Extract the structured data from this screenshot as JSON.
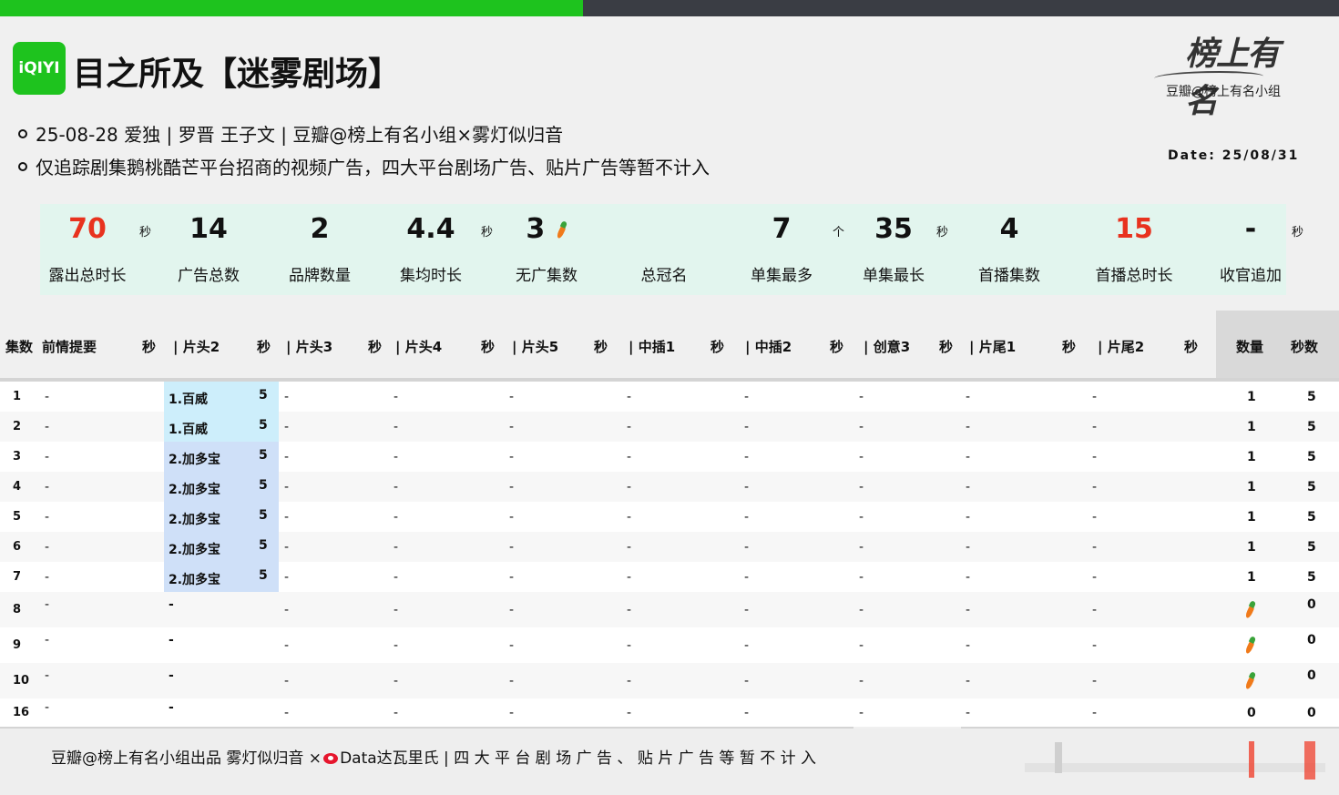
{
  "header": {
    "logo_text": "iQIYI",
    "title": "目之所及【迷雾剧场】",
    "brand_script": "榜上有名",
    "brand_sub": "豆瓣@榜上有名小组",
    "info_line1": "25-08-28  爱独 |  罗晋 王子文 | 豆瓣@榜上有名小组×雾灯似归音",
    "info_line2": "仅追踪剧集鹅桃酷芒平台招商的视频广告，四大平台剧场广告、贴片广告等暂不计入",
    "date": "Date: 25/08/31"
  },
  "stats": {
    "items": [
      {
        "value": "70",
        "label": "露出总时长",
        "red": true
      },
      {
        "value": "14",
        "label": "广告总数"
      },
      {
        "value": "2",
        "label": "品牌数量"
      },
      {
        "value": "4.4",
        "label": "集均时长"
      },
      {
        "value": "3",
        "label": "无广集数"
      },
      {
        "value": "",
        "label": "总冠名"
      },
      {
        "value": "7",
        "label": "单集最多"
      },
      {
        "value": "35",
        "label": "单集最长"
      },
      {
        "value": "4",
        "label": "首播集数"
      },
      {
        "value": "15",
        "label": "首播总时长",
        "red": true
      },
      {
        "value": "-",
        "label": "收官追加"
      }
    ],
    "unit_sec": "秒",
    "unit_ge": "个"
  },
  "table": {
    "headers": [
      "集数",
      "前情提要",
      "秒",
      "| 片头2",
      "秒",
      "| 片头3",
      "秒",
      "| 片头4",
      "秒",
      "| 片头5",
      "秒",
      "| 中插1",
      "秒",
      "| 中插2",
      "秒",
      "| 创意3",
      "秒",
      "| 片尾1",
      "秒",
      "| 片尾2",
      "秒",
      "数量",
      "秒数"
    ],
    "dash": "-",
    "rows": [
      {
        "ep": "1",
        "ad": "1.百威",
        "sec": "5",
        "count": "1",
        "secs": "5"
      },
      {
        "ep": "2",
        "ad": "1.百威",
        "sec": "5",
        "count": "1",
        "secs": "5"
      },
      {
        "ep": "3",
        "ad": "2.加多宝",
        "sec": "5",
        "count": "1",
        "secs": "5"
      },
      {
        "ep": "4",
        "ad": "2.加多宝",
        "sec": "5",
        "count": "1",
        "secs": "5"
      },
      {
        "ep": "5",
        "ad": "2.加多宝",
        "sec": "5",
        "count": "1",
        "secs": "5"
      },
      {
        "ep": "6",
        "ad": "2.加多宝",
        "sec": "5",
        "count": "1",
        "secs": "5"
      },
      {
        "ep": "7",
        "ad": "2.加多宝",
        "sec": "5",
        "count": "1",
        "secs": "5"
      },
      {
        "ep": "8",
        "ad": "-",
        "sec": "",
        "count": "carrot",
        "secs": "0"
      },
      {
        "ep": "9",
        "ad": "-",
        "sec": "",
        "count": "carrot",
        "secs": "0"
      },
      {
        "ep": "10",
        "ad": "-",
        "sec": "",
        "count": "carrot",
        "secs": "0"
      },
      {
        "ep": "16",
        "ad": "-",
        "sec": "",
        "count": "0",
        "secs": "0"
      }
    ]
  },
  "footer": {
    "text_left": "豆瓣@榜上有名小组出品  雾灯似归音 ×",
    "text_right": "Data达瓦里氏 | 四 大 平 台 剧 场 广 告 、 贴 片 广 告 等 暂 不 计 入"
  }
}
